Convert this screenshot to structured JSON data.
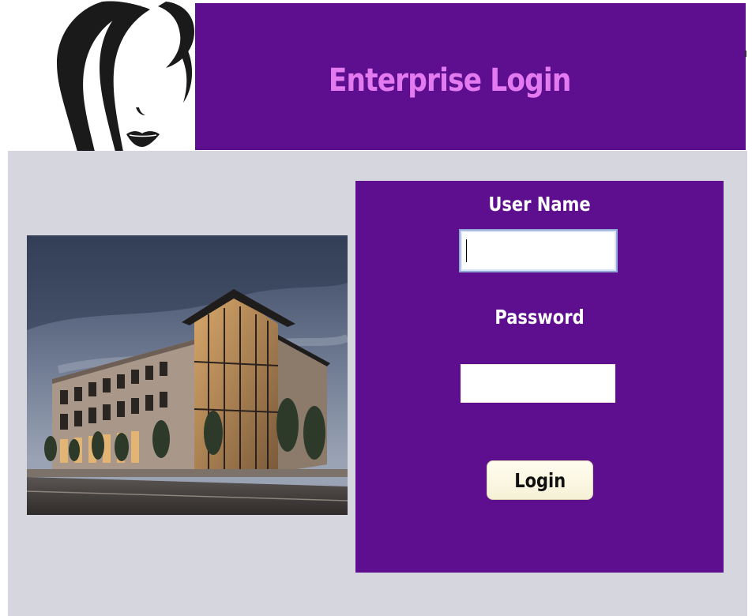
{
  "header": {
    "title": "Enterprise Login"
  },
  "logo": {
    "icon": "woman-face-silhouette-icon"
  },
  "photo": {
    "description_icon": "office-building-photo"
  },
  "login_form": {
    "username_label": "User Name",
    "username_value": "",
    "password_label": "Password",
    "password_value": "",
    "login_button_label": "Login"
  },
  "colors": {
    "header_background": "#5e0f8f",
    "title_color": "#e47af0",
    "panel_background": "#5e0f8f",
    "page_background": "#d6d7de",
    "button_background": "#fbf7e2"
  }
}
